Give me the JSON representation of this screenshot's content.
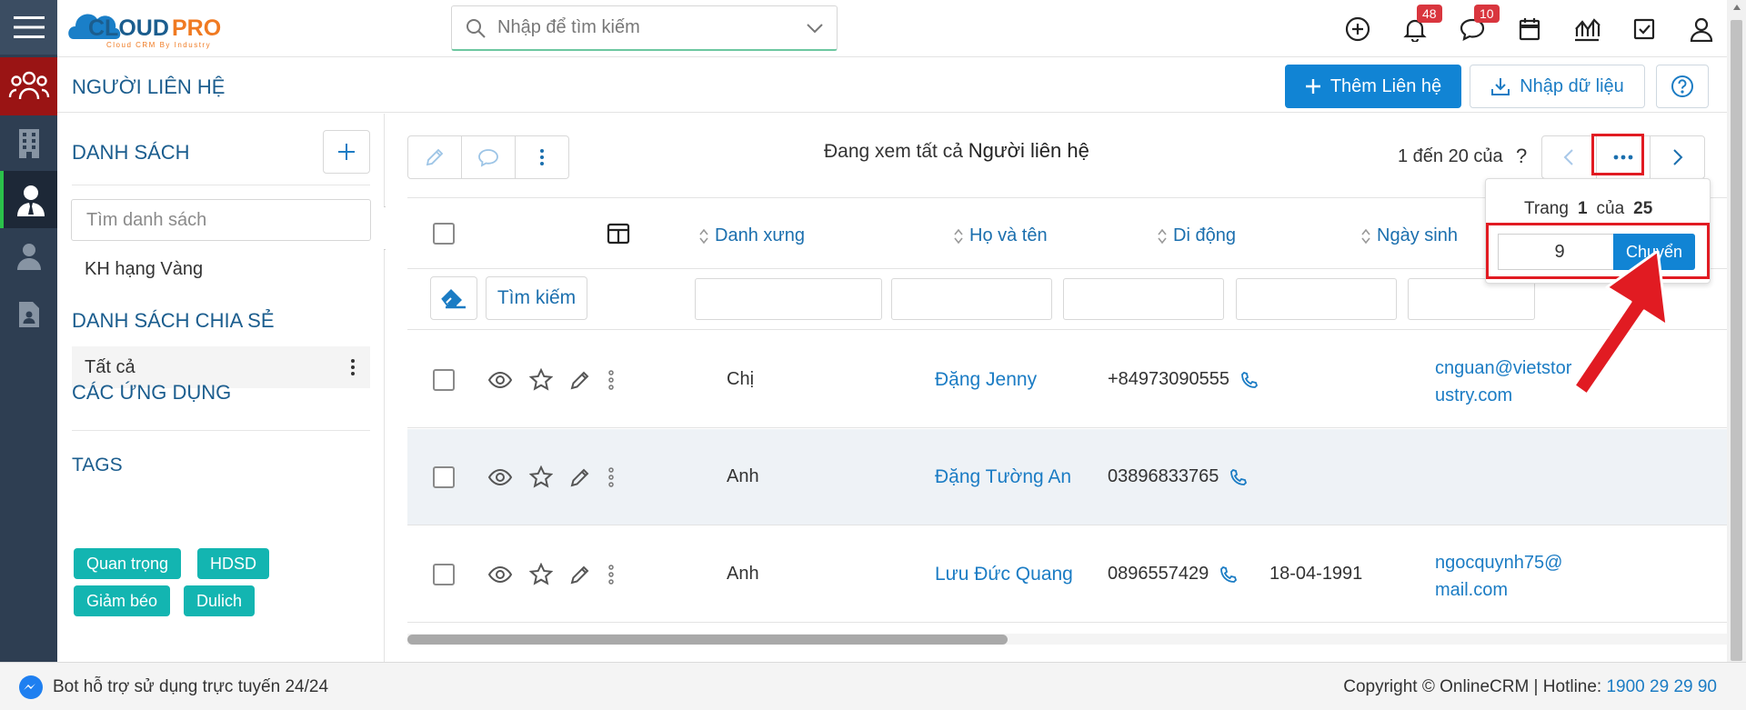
{
  "app": {
    "logo_text": "CLOUDPRO",
    "logo_sub": "Cloud CRM By Industry"
  },
  "search": {
    "placeholder": "Nhập để tìm kiếm"
  },
  "topbar": {
    "notifications_count": "48",
    "messages_count": "10"
  },
  "header": {
    "title": "NGƯỜI LIÊN HỆ",
    "add_label": "Thêm Liên hệ",
    "import_label": "Nhập dữ liệu"
  },
  "sidebar": {
    "lists_title": "DANH SÁCH",
    "search_placeholder": "Tìm danh sách",
    "lists": [
      "KH hạng Vàng"
    ],
    "shared_title": "DANH SÁCH CHIA SẺ",
    "shared": [
      "Tất cả"
    ],
    "apps_title": "CÁC ỨNG DỤNG",
    "tags_title": "TAGS",
    "tags": [
      "Quan trọng",
      "HDSD",
      "Giảm béo",
      "Dulich"
    ]
  },
  "main": {
    "viewing_prefix": "Đang xem tất cả",
    "viewing_module": "Người liên hệ",
    "pager_text": "1 đến 20 của",
    "pager_q": "?",
    "columns": [
      "Danh xưng",
      "Họ và tên",
      "Di động",
      "Ngày sinh"
    ],
    "search_button": "Tìm kiếm",
    "rows": [
      {
        "salutation": "Chị",
        "name": "Đặng Jenny",
        "mobile": "+84973090555",
        "birthday": "",
        "email_1": "cnguan@vietstor",
        "email_2": "ustry.com"
      },
      {
        "salutation": "Anh",
        "name": "Đặng Tường An",
        "mobile": "03896833765",
        "birthday": "",
        "email_1": "",
        "email_2": ""
      },
      {
        "salutation": "Anh",
        "name": "Lưu Đức Quang",
        "mobile": "0896557429",
        "birthday": "18-04-1991",
        "email_1": "ngocquynh75@",
        "email_2": "mail.com"
      }
    ]
  },
  "popover": {
    "page_label": "Trang",
    "page_current": "1",
    "of_label": "của",
    "page_total": "25",
    "input_value": "9",
    "go_label": "Chuyển"
  },
  "footer": {
    "bot": "Bot hỗ trợ sử dụng trực tuyến 24/24",
    "copyright": "Copyright © OnlineCRM | Hotline: ",
    "hotline": "1900 29 29 90"
  },
  "colors": {
    "primary": "#1184d4",
    "rail": "#2e3e52",
    "active_rail": "#9a1414",
    "tag": "#13b5b1",
    "highlight": "#e11b22",
    "badge": "#d9363e"
  }
}
